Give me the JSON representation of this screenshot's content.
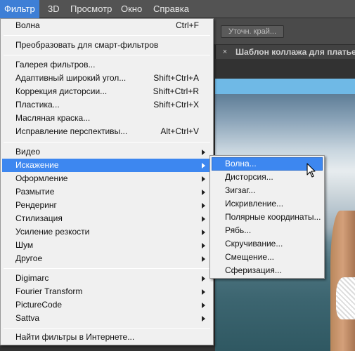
{
  "menubar": {
    "items": [
      {
        "label": "Фильтр",
        "active": true
      },
      {
        "label": "3D"
      },
      {
        "label": "Просмотр"
      },
      {
        "label": "Окно"
      },
      {
        "label": "Справка"
      }
    ]
  },
  "options_bar": {
    "refine_edge_label": "Уточн. край..."
  },
  "document_tab": {
    "close_glyph": "×",
    "title": "Шаблон коллажа для платьев"
  },
  "filter_menu": {
    "top": [
      {
        "label": "Волна",
        "shortcut": "Ctrl+F"
      }
    ],
    "smart": [
      {
        "label": "Преобразовать для смарт-фильтров"
      }
    ],
    "gallery": [
      {
        "label": "Галерея фильтров..."
      },
      {
        "label": "Адаптивный широкий угол...",
        "shortcut": "Shift+Ctrl+A"
      },
      {
        "label": "Коррекция дисторсии...",
        "shortcut": "Shift+Ctrl+R"
      },
      {
        "label": "Пластика...",
        "shortcut": "Shift+Ctrl+X"
      },
      {
        "label": "Масляная краска..."
      },
      {
        "label": "Исправление перспективы...",
        "shortcut": "Alt+Ctrl+V"
      }
    ],
    "groups": [
      {
        "label": "Видео"
      },
      {
        "label": "Искажение",
        "highlighted": true
      },
      {
        "label": "Оформление"
      },
      {
        "label": "Размытие"
      },
      {
        "label": "Рендеринг"
      },
      {
        "label": "Стилизация"
      },
      {
        "label": "Усиление резкости"
      },
      {
        "label": "Шум"
      },
      {
        "label": "Другое"
      }
    ],
    "plugins": [
      {
        "label": "Digimarc"
      },
      {
        "label": "Fourier Transform"
      },
      {
        "label": "PictureCode"
      },
      {
        "label": "Sattva"
      }
    ],
    "online": [
      {
        "label": "Найти фильтры в Интернете..."
      }
    ]
  },
  "distort_menu": {
    "items": [
      {
        "label": "Волна...",
        "highlighted": true
      },
      {
        "label": "Дисторсия..."
      },
      {
        "label": "Зигзаг..."
      },
      {
        "label": "Искривление..."
      },
      {
        "label": "Полярные координаты..."
      },
      {
        "label": "Рябь..."
      },
      {
        "label": "Скручивание..."
      },
      {
        "label": "Смещение..."
      },
      {
        "label": "Сферизация..."
      }
    ]
  },
  "colors": {
    "menu_highlight": "#3d87f0",
    "menubar_active": "#3e7fd6",
    "menu_bg": "#f0f0f0"
  }
}
